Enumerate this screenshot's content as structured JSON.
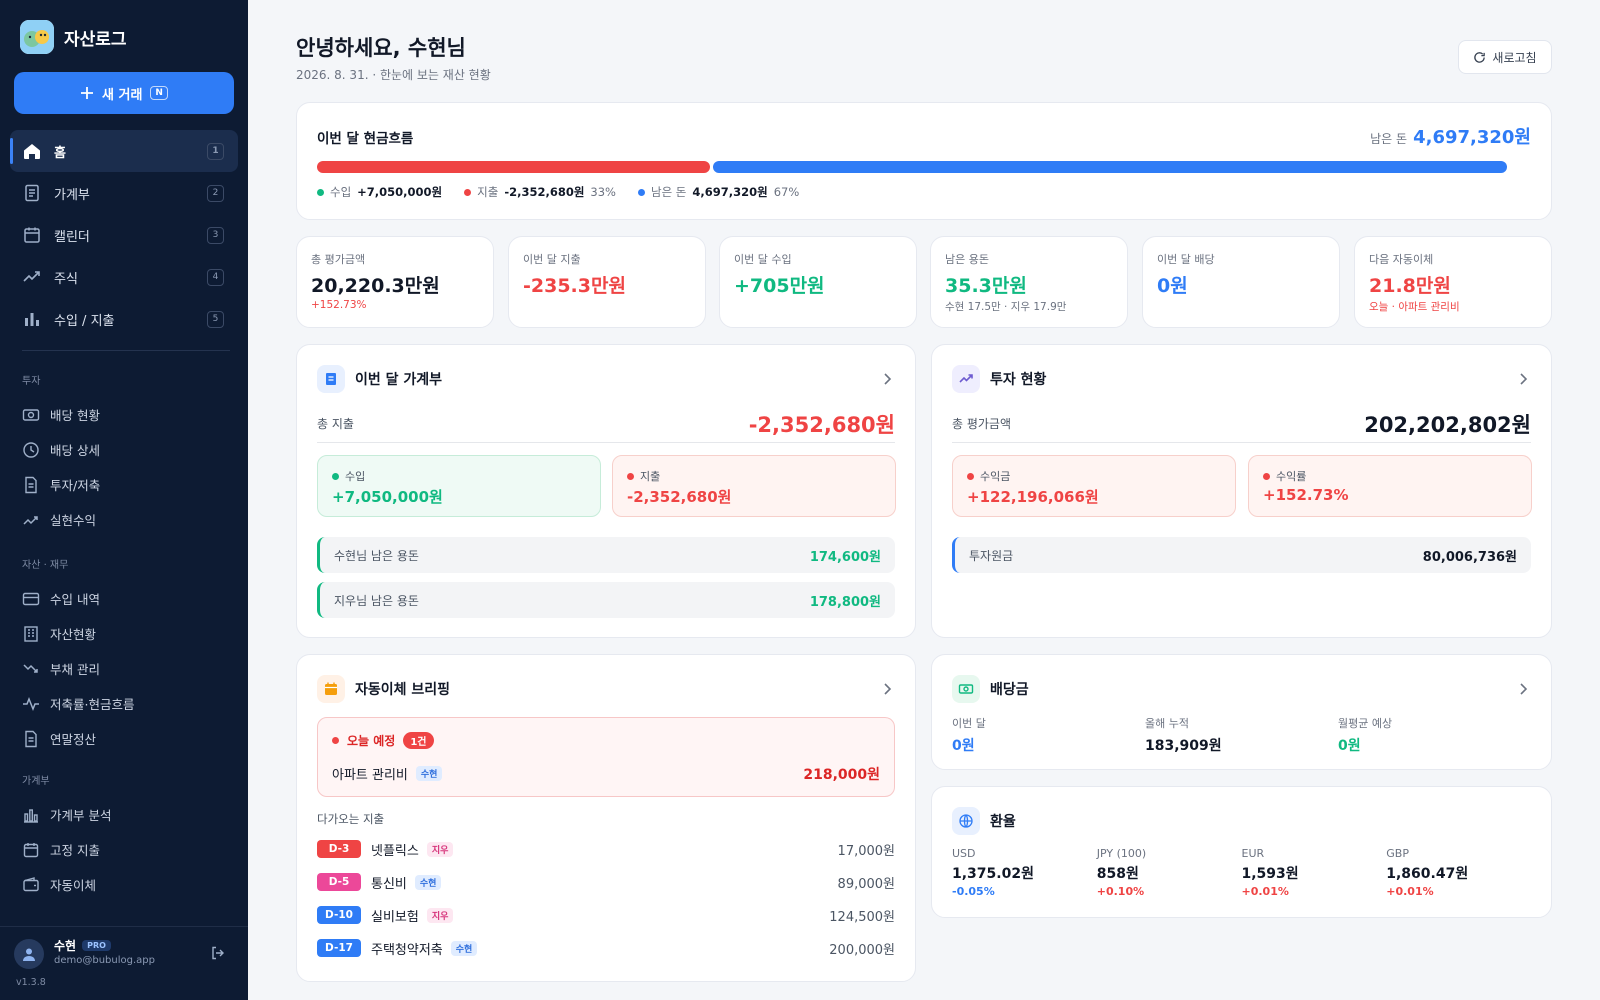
{
  "colors": {
    "red": "#ef4444",
    "blue": "#2f7cf6",
    "green": "#10b981",
    "dark": "#0d1b33"
  },
  "app": {
    "name": "자산로그"
  },
  "sidebar": {
    "new_tx": {
      "label": "새 거래",
      "shortcut": "N"
    },
    "main": [
      {
        "label": "홈",
        "num": "1",
        "icon": "home-icon"
      },
      {
        "label": "가계부",
        "num": "2",
        "icon": "ledger-icon"
      },
      {
        "label": "캘린더",
        "num": "3",
        "icon": "calendar-icon"
      },
      {
        "label": "주식",
        "num": "4",
        "icon": "trend-up-icon"
      },
      {
        "label": "수입 / 지출",
        "num": "5",
        "icon": "bar-chart-icon"
      }
    ],
    "sections": [
      {
        "title": "투자",
        "items": [
          {
            "label": "배당 현황",
            "icon": "money-icon"
          },
          {
            "label": "배당 상세",
            "icon": "clock-icon"
          },
          {
            "label": "투자/저축",
            "icon": "document-icon"
          },
          {
            "label": "실현수익",
            "icon": "trend-up-icon"
          }
        ]
      },
      {
        "title": "자산 · 재무",
        "items": [
          {
            "label": "수입 내역",
            "icon": "card-icon"
          },
          {
            "label": "자산현황",
            "icon": "building-icon"
          },
          {
            "label": "부채 관리",
            "icon": "trend-down-icon"
          },
          {
            "label": "저축률·현금흐름",
            "icon": "pulse-icon"
          },
          {
            "label": "연말정산",
            "icon": "document-icon"
          }
        ]
      },
      {
        "title": "가계부",
        "items": [
          {
            "label": "가계부 분석",
            "icon": "bar-chart-icon"
          },
          {
            "label": "고정 지출",
            "icon": "calendar-icon"
          },
          {
            "label": "자동이체",
            "icon": "wallet-icon"
          }
        ]
      }
    ],
    "user": {
      "name": "수현",
      "badge": "PRO",
      "email": "demo@bubulog.app"
    },
    "version": "v1.3.8"
  },
  "header": {
    "title": "안녕하세요, 수현님",
    "subtitle": "2026. 8. 31. · 한눈에 보는 재산 현황",
    "refresh": "새로고침"
  },
  "cashflow": {
    "title": "이번 달 현금흐름",
    "remain_label": "남은 돈",
    "remain_value": "4,697,320원",
    "expense_share": 0.33,
    "income": {
      "label": "수입",
      "value": "+7,050,000원"
    },
    "expense": {
      "label": "지출",
      "value": "-2,352,680원",
      "pct": "33%"
    },
    "remain": {
      "label": "남은 돈",
      "value": "4,697,320원",
      "pct": "67%"
    }
  },
  "stats": [
    {
      "label": "총 평가금액",
      "value": "20,220.3만원",
      "sub": "+152.73%",
      "color": "#111827",
      "subcolor": "#ef4444"
    },
    {
      "label": "이번 달 지출",
      "value": "-235.3만원",
      "sub": "",
      "color": "#ef4444",
      "subcolor": "#6b7280"
    },
    {
      "label": "이번 달 수입",
      "value": "+705만원",
      "sub": "",
      "color": "#10b981",
      "subcolor": "#6b7280"
    },
    {
      "label": "남은 용돈",
      "value": "35.3만원",
      "sub": "수현 17.5만 · 지우 17.9만",
      "color": "#10b981",
      "subcolor": "#6b7280"
    },
    {
      "label": "이번 달 배당",
      "value": "0원",
      "sub": "",
      "color": "#2f7cf6",
      "subcolor": "#6b7280"
    },
    {
      "label": "다음 자동이체",
      "value": "21.8만원",
      "sub": "오늘 · 아파트 관리비",
      "color": "#ef4444",
      "subcolor": "#ef4444"
    }
  ],
  "ledger": {
    "title": "이번 달 가계부",
    "total_label": "총 지출",
    "total_value": "-2,352,680원",
    "income": {
      "label": "수입",
      "value": "+7,050,000원"
    },
    "expense": {
      "label": "지출",
      "value": "-2,352,680원"
    },
    "allowances": [
      {
        "label": "수현님 남은 용돈",
        "value": "174,600원"
      },
      {
        "label": "지우님 남은 용돈",
        "value": "178,800원"
      }
    ]
  },
  "invest": {
    "title": "투자 현황",
    "total_label": "총 평가금액",
    "total_value": "202,202,802원",
    "profit": {
      "label": "수익금",
      "value": "+122,196,066원"
    },
    "rate": {
      "label": "수익률",
      "value": "+152.73%"
    },
    "principal": {
      "label": "투자원금",
      "value": "80,006,736원"
    }
  },
  "autopay": {
    "title": "자동이체 브리핑",
    "today_label": "오늘 예정",
    "today_count": "1건",
    "today_item": {
      "name": "아파트 관리비",
      "tag": "수현",
      "amount": "218,000원"
    },
    "upcoming_label": "다가오는 지출",
    "upcoming": [
      {
        "d": "D-3",
        "name": "넷플릭스",
        "tag": "지우",
        "amount": "17,000원",
        "color": "#ef4444"
      },
      {
        "d": "D-5",
        "name": "통신비",
        "tag": "수현",
        "amount": "89,000원",
        "color": "#ec4899"
      },
      {
        "d": "D-10",
        "name": "실비보험",
        "tag": "지우",
        "amount": "124,500원",
        "color": "#2f7cf6"
      },
      {
        "d": "D-17",
        "name": "주택청약저축",
        "tag": "수현",
        "amount": "200,000원",
        "color": "#2f7cf6"
      }
    ]
  },
  "dividend": {
    "title": "배당금",
    "cols": [
      {
        "label": "이번 달",
        "value": "0원",
        "color": "#2f7cf6"
      },
      {
        "label": "올해 누적",
        "value": "183,909원",
        "color": "#111827"
      },
      {
        "label": "월평균 예상",
        "value": "0원",
        "color": "#10b981"
      }
    ]
  },
  "fx": {
    "title": "환율",
    "items": [
      {
        "code": "USD",
        "rate": "1,375.02원",
        "change": "-0.05%",
        "color": "#2f7cf6"
      },
      {
        "code": "JPY (100)",
        "rate": "858원",
        "change": "+0.10%",
        "color": "#ef4444"
      },
      {
        "code": "EUR",
        "rate": "1,593원",
        "change": "+0.01%",
        "color": "#ef4444"
      },
      {
        "code": "GBP",
        "rate": "1,860.47원",
        "change": "+0.01%",
        "color": "#ef4444"
      }
    ]
  }
}
